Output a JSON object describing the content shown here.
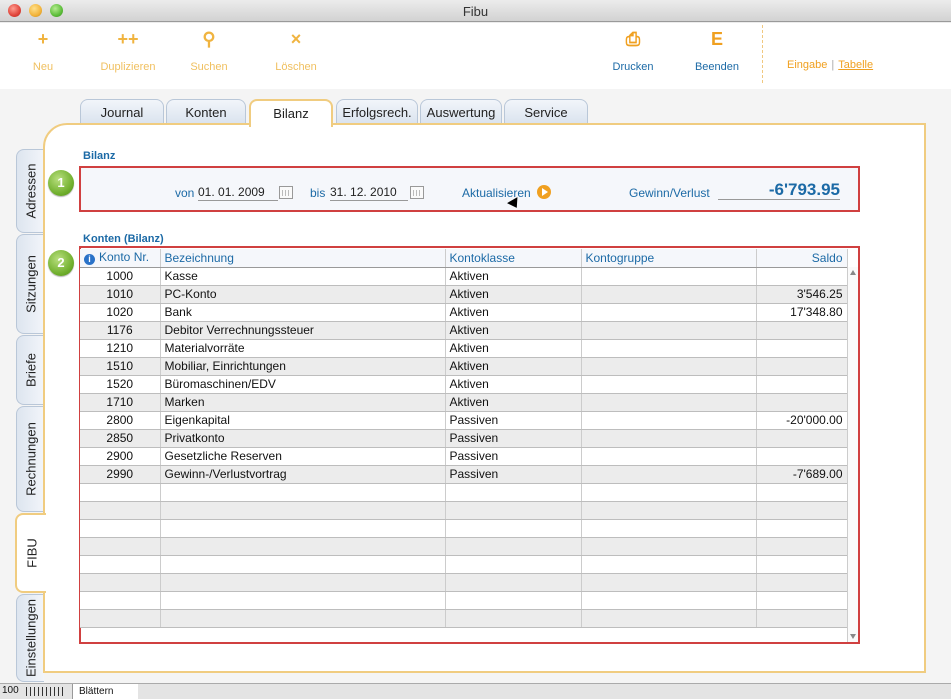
{
  "window": {
    "title": "Fibu"
  },
  "toolbar": {
    "new": {
      "icon": "+",
      "label": "Neu"
    },
    "duplicate": {
      "icon": "++",
      "label": "Duplizieren"
    },
    "search": {
      "icon": "⚲",
      "label": "Suchen"
    },
    "delete": {
      "icon": "×",
      "label": "Löschen"
    },
    "print": {
      "icon": "⎙",
      "label": "Drucken"
    },
    "quit": {
      "icon": "E",
      "label": "Beenden"
    },
    "mode_entry": "Eingabe",
    "mode_separator": "|",
    "mode_table": "Tabelle"
  },
  "tabs": [
    "Journal",
    "Konten",
    "Bilanz",
    "Erfolgsrech.",
    "Auswertung",
    "Service"
  ],
  "active_tab": "Bilanz",
  "side_tabs": [
    "Adressen",
    "Sitzungen",
    "Briefe",
    "Rechnungen",
    "FIBU",
    "Einstellungen"
  ],
  "active_side_tab": "FIBU",
  "section1": {
    "badge": "1",
    "title": "Bilanz",
    "from_label": "von",
    "from_date": "01. 01. 2009",
    "to_label": "bis",
    "to_date": "31. 12. 2010",
    "update_label": "Aktualisieren",
    "result_label": "Gewinn/Verlust",
    "result_value": "-6'793.95"
  },
  "section2": {
    "badge": "2",
    "title": "Konten (Bilanz)",
    "columns": [
      "Konto Nr.",
      "Bezeichnung",
      "Kontoklasse",
      "Kontogruppe",
      "Saldo"
    ],
    "rows": [
      {
        "nr": "1000",
        "name": "Kasse",
        "klasse": "Aktiven",
        "gruppe": "",
        "saldo": ""
      },
      {
        "nr": "1010",
        "name": "PC-Konto",
        "klasse": "Aktiven",
        "gruppe": "",
        "saldo": "3'546.25"
      },
      {
        "nr": "1020",
        "name": "Bank",
        "klasse": "Aktiven",
        "gruppe": "",
        "saldo": "17'348.80"
      },
      {
        "nr": "1176",
        "name": "Debitor Verrechnungssteuer",
        "klasse": "Aktiven",
        "gruppe": "",
        "saldo": ""
      },
      {
        "nr": "1210",
        "name": "Materialvorräte",
        "klasse": "Aktiven",
        "gruppe": "",
        "saldo": ""
      },
      {
        "nr": "1510",
        "name": "Mobiliar, Einrichtungen",
        "klasse": "Aktiven",
        "gruppe": "",
        "saldo": ""
      },
      {
        "nr": "1520",
        "name": "Büromaschinen/EDV",
        "klasse": "Aktiven",
        "gruppe": "",
        "saldo": ""
      },
      {
        "nr": "1710",
        "name": "Marken",
        "klasse": "Aktiven",
        "gruppe": "",
        "saldo": ""
      },
      {
        "nr": "2800",
        "name": "Eigenkapital",
        "klasse": "Passiven",
        "gruppe": "",
        "saldo": "-20'000.00"
      },
      {
        "nr": "2850",
        "name": "Privatkonto",
        "klasse": "Passiven",
        "gruppe": "",
        "saldo": ""
      },
      {
        "nr": "2900",
        "name": "Gesetzliche Reserven",
        "klasse": "Passiven",
        "gruppe": "",
        "saldo": ""
      },
      {
        "nr": "2990",
        "name": "Gewinn-/Verlustvortrag",
        "klasse": "Passiven",
        "gruppe": "",
        "saldo": "-7'689.00"
      }
    ],
    "empty_rows": 8
  },
  "status": {
    "zoom": "100",
    "mode": "Blättern"
  }
}
